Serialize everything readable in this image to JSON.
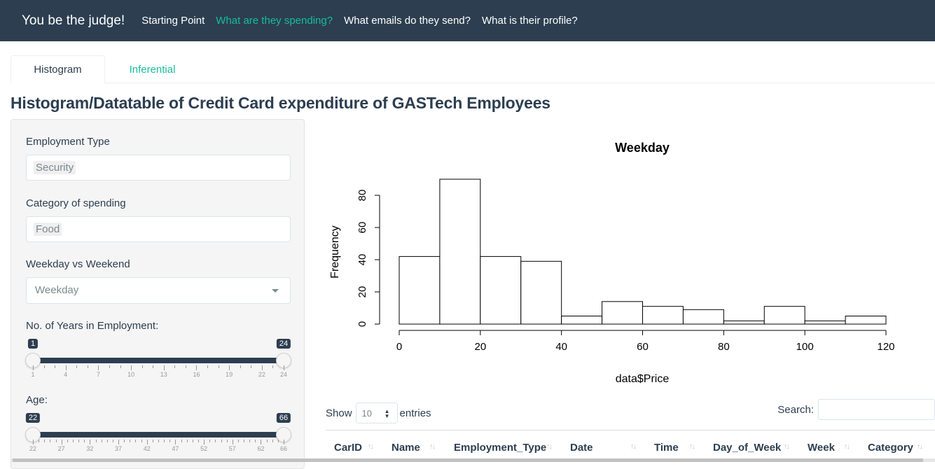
{
  "navbar": {
    "brand": "You be the judge!",
    "items": [
      {
        "label": "Starting Point",
        "active": false
      },
      {
        "label": "What are they spending?",
        "active": true
      },
      {
        "label": "What emails do they send?",
        "active": false
      },
      {
        "label": "What is their profile?",
        "active": false
      }
    ]
  },
  "tabs": [
    {
      "label": "Histogram",
      "active": true
    },
    {
      "label": "Inferential",
      "active": false
    }
  ],
  "page_title": "Histogram/Datatable of Credit Card expenditure of GASTech Employees",
  "sidebar": {
    "employment_type": {
      "label": "Employment Type",
      "value": "Security"
    },
    "category": {
      "label": "Category of spending",
      "value": "Food"
    },
    "weekday": {
      "label": "Weekday vs Weekend",
      "value": "Weekday"
    },
    "years": {
      "label": "No. of Years in Employment:",
      "min": 1,
      "max": 24,
      "from": 1,
      "to": 24,
      "tick_labels": [
        "1",
        "4",
        "7",
        "10",
        "13",
        "16",
        "19",
        "22",
        "24"
      ]
    },
    "age": {
      "label": "Age:",
      "min": 22,
      "max": 66,
      "from": 22,
      "to": 66,
      "tick_labels": [
        "22",
        "27",
        "32",
        "37",
        "42",
        "47",
        "52",
        "57",
        "62",
        "66"
      ]
    }
  },
  "chart_data": {
    "type": "bar",
    "title": "Weekday",
    "xlabel": "data$Price",
    "ylabel": "Frequency",
    "bin_edges": [
      0,
      10,
      20,
      30,
      40,
      50,
      60,
      70,
      80,
      90,
      100,
      110,
      120
    ],
    "values": [
      42,
      90,
      42,
      39,
      5,
      14,
      11,
      9,
      2,
      11,
      2,
      5
    ],
    "x_ticks": [
      0,
      20,
      40,
      60,
      80,
      100,
      120
    ],
    "y_ticks": [
      0,
      20,
      40,
      60,
      80
    ],
    "xlim": [
      0,
      120
    ],
    "ylim": [
      0,
      90
    ]
  },
  "datatable": {
    "show_label": "Show",
    "entries_value": "10",
    "entries_label": "entries",
    "search_label": "Search:",
    "columns": [
      "CarID",
      "Name",
      "Employment_Type",
      "Date",
      "Time",
      "Day_of_Week",
      "Week",
      "Category"
    ]
  }
}
